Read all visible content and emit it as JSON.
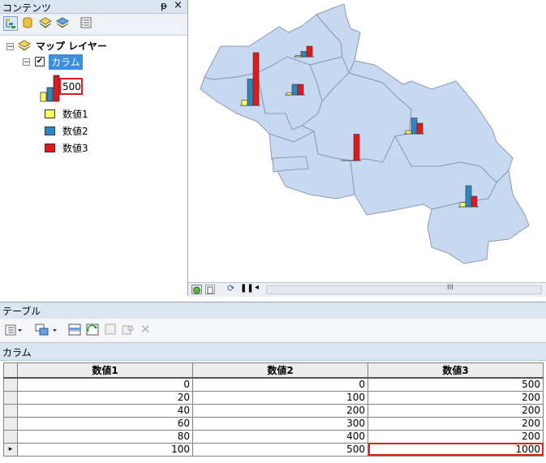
{
  "contents": {
    "title": "コンテンツ",
    "pin": "ᵽ",
    "close": "×",
    "root_layer": "マップ レイヤー",
    "layer": "カラム",
    "chart_label": "500",
    "legend": [
      {
        "label": "数値1",
        "color": "#ffff66"
      },
      {
        "label": "数値2",
        "color": "#2e86c1"
      },
      {
        "label": "数値3",
        "color": "#e0191f"
      }
    ]
  },
  "map": {
    "fill_color": "#c6d9f1",
    "border_color": "#8c9ab0",
    "statusbar_mid": "III"
  },
  "table": {
    "title": "テーブル",
    "layer_tab": "カラム",
    "columns": [
      "数値1",
      "数値2",
      "数値3"
    ],
    "rows": [
      [
        "0",
        "0",
        "500"
      ],
      [
        "20",
        "100",
        "200"
      ],
      [
        "40",
        "200",
        "200"
      ],
      [
        "60",
        "300",
        "200"
      ],
      [
        "80",
        "400",
        "200"
      ],
      [
        "100",
        "500",
        "1000"
      ]
    ],
    "current_row_marker": "▸"
  }
}
